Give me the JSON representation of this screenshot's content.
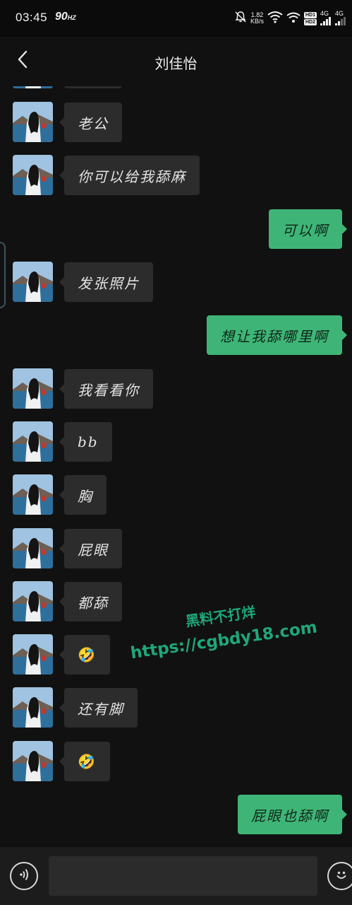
{
  "status_bar": {
    "time": "03:45",
    "refresh_rate": "90",
    "refresh_unit": "HZ",
    "speed_value": "1.82",
    "speed_unit": "KB/s",
    "hd1": "HD1",
    "hd2": "HD2",
    "net1": "4G",
    "net2": "4G"
  },
  "header": {
    "title": "刘佳怡"
  },
  "messages": [
    {
      "side": "in",
      "text": "老公"
    },
    {
      "side": "in",
      "text": "你可以给我舔麻"
    },
    {
      "side": "out",
      "text": "可以啊"
    },
    {
      "side": "in",
      "text": "发张照片"
    },
    {
      "side": "out",
      "text": "想让我舔哪里啊"
    },
    {
      "side": "in",
      "text": "我看看你"
    },
    {
      "side": "in",
      "text": "bb"
    },
    {
      "side": "in",
      "text": "胸"
    },
    {
      "side": "in",
      "text": "屁眼"
    },
    {
      "side": "in",
      "text": "都舔"
    },
    {
      "side": "in",
      "text": "🤣"
    },
    {
      "side": "in",
      "text": "还有脚"
    },
    {
      "side": "in",
      "text": "🤣"
    },
    {
      "side": "out",
      "text": "屁眼也舔啊"
    }
  ],
  "watermark": {
    "line1": "黑料不打烊",
    "line2": "https://cgbdy18.com"
  },
  "input": {
    "value": "",
    "placeholder": ""
  },
  "colors": {
    "background": "#111111",
    "incoming_bubble": "#2c2c2c",
    "outgoing_bubble": "#3eb576",
    "watermark": "#1fa77a"
  },
  "icons": {
    "back": "chevron-left-icon",
    "voice": "voice-icon",
    "emoji": "smiley-icon"
  }
}
